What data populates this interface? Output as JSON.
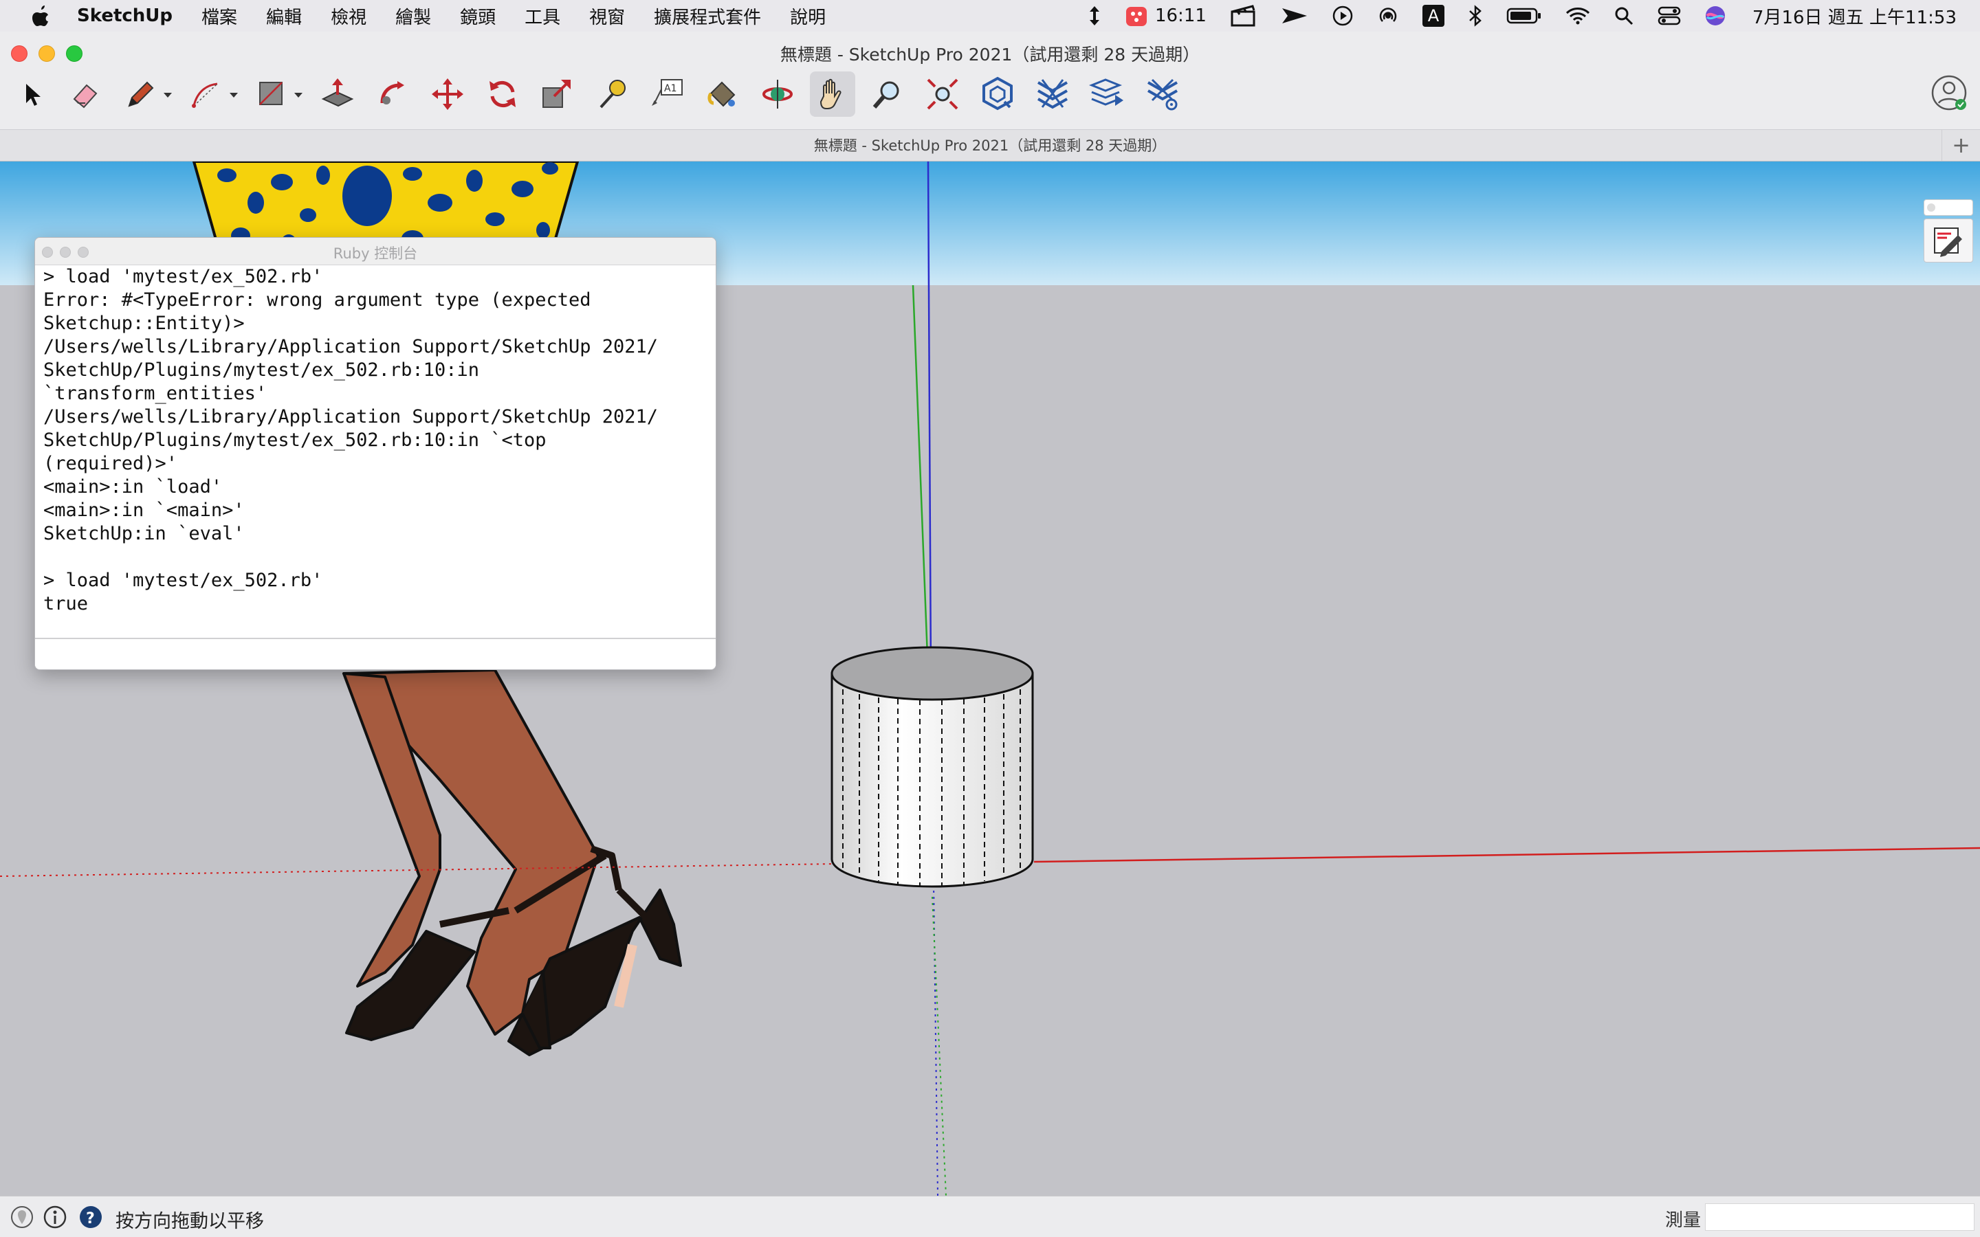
{
  "menubar": {
    "app_name": "SketchUp",
    "items": [
      "檔案",
      "編輯",
      "檢視",
      "繪製",
      "鏡頭",
      "工具",
      "視窗",
      "擴展程式套件",
      "說明"
    ],
    "timer": "16:11",
    "clock": "7月16日 週五 上午11:53",
    "input_method": "A"
  },
  "window": {
    "title": "無標題 - SketchUp Pro 2021（試用還剩 28 天過期）",
    "tab_title": "無標題 - SketchUp Pro 2021（試用還剩 28 天過期）",
    "tab_add": "+"
  },
  "toolbar": {
    "tools": [
      "select-tool",
      "eraser-tool",
      "pencil-tool",
      "arc-tool",
      "rectangle-tool",
      "push-pull-tool",
      "follow-me-tool",
      "move-tool",
      "rotate-tool",
      "scale-tool",
      "tape-measure-tool",
      "text-tool",
      "paint-bucket-tool",
      "orbit-tool",
      "pan-tool",
      "zoom-tool",
      "zoom-extents-tool",
      "warehouse-tool",
      "extension-warehouse-tool",
      "layout-tool",
      "extension-manager-tool"
    ]
  },
  "ruby_console": {
    "title": "Ruby 控制台",
    "lines": [
      "> load 'mytest/ex_502.rb'",
      "Error: #<TypeError: wrong argument type (expected",
      "Sketchup::Entity)>",
      "/Users/wells/Library/Application Support/SketchUp 2021/",
      "SketchUp/Plugins/mytest/ex_502.rb:10:in",
      "`transform_entities'",
      "/Users/wells/Library/Application Support/SketchUp 2021/",
      "SketchUp/Plugins/mytest/ex_502.rb:10:in `<top",
      "(required)>'",
      "<main>:in `load'",
      "<main>:in `<main>'",
      "SketchUp:in `eval'",
      "",
      "> load 'mytest/ex_502.rb'",
      "true"
    ],
    "input_value": ""
  },
  "statusbar": {
    "hint": "按方向拖動以平移",
    "measure_label": "測量",
    "measure_value": ""
  },
  "colors": {
    "sky_top": "#3fa6e0",
    "sky_bottom": "#cfe9f7",
    "ground": "#c3c3c8",
    "axis_red": "#d21e1e",
    "axis_green": "#2aa82a",
    "axis_blue": "#2c2ccc",
    "skin": "#a65b3f",
    "dress_yellow": "#f5d20c",
    "dress_dots": "#0b3b8c"
  }
}
